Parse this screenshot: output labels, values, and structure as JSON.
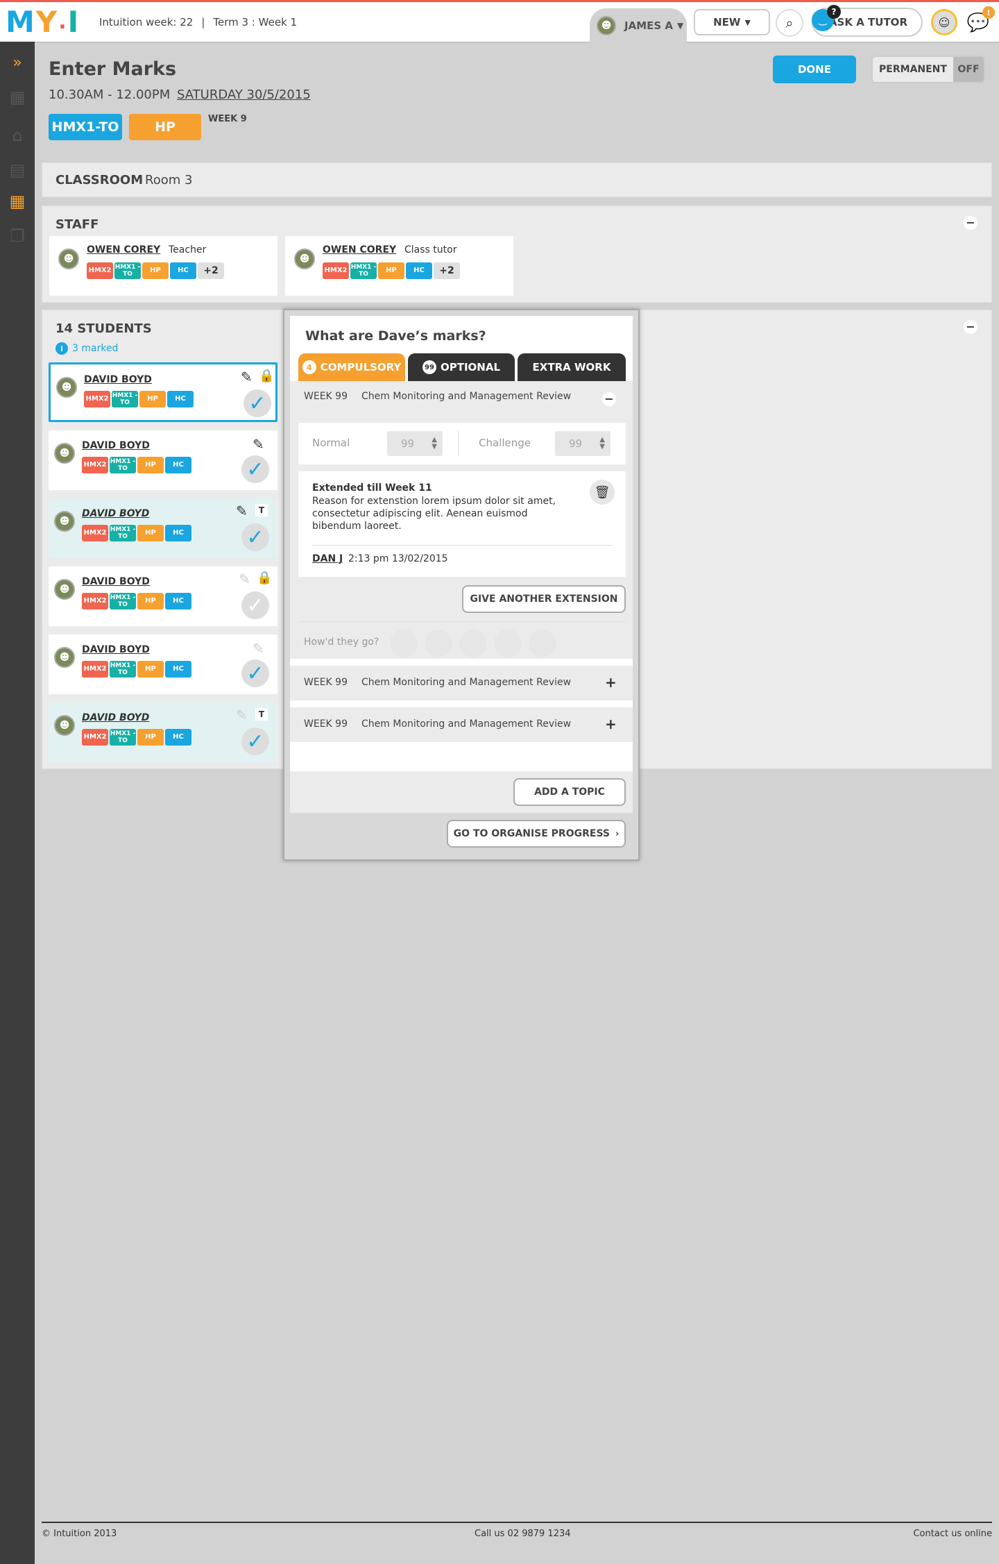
{
  "topbar": {
    "logo_letters": [
      "M",
      "Y",
      "I"
    ],
    "week_info": "Intuition week: 22",
    "separator": "|",
    "term_info": "Term 3 : Week 1",
    "user_label": "JAMES A",
    "new_label": "NEW",
    "ask_tutor_label": "ASK A TUTOR",
    "question_badge": "?",
    "alert_badge": "!"
  },
  "header": {
    "title": "Enter Marks",
    "time": "10.30AM - 12.00PM",
    "date": "SATURDAY 30/5/2015",
    "tag1": "HMX1-TO",
    "tag2": "HP",
    "week": "WEEK 9",
    "done_label": "DONE",
    "permanent_label": "PERMANENT",
    "off_label": "OFF"
  },
  "classroom": {
    "label": "CLASSROOM",
    "room": "Room 3"
  },
  "staff": {
    "title": "STAFF",
    "members": [
      {
        "name": "OWEN COREY",
        "role": "Teacher",
        "badges": [
          "HMX2",
          "HMX1 -TO",
          "HP",
          "HC"
        ],
        "more": "+2"
      },
      {
        "name": "OWEN COREY",
        "role": "Class tutor",
        "badges": [
          "HMX2",
          "HMX1 -TO",
          "HP",
          "HC"
        ],
        "more": "+2"
      }
    ]
  },
  "students": {
    "title": "14 STUDENTS",
    "info_icon": "i",
    "marked": "3 marked",
    "list": [
      {
        "name": "DAVID BOYD",
        "badges": [
          "HMX2",
          "HMX1 -TO",
          "HP",
          "HC"
        ],
        "flag": ""
      },
      {
        "name": "DAVID BOYD",
        "badges": [
          "HMX2",
          "HMX1 -TO",
          "HP",
          "HC"
        ],
        "flag": ""
      },
      {
        "name": "DAVID BOYD",
        "badges": [
          "HMX2",
          "HMX1 -TO",
          "HP",
          "HC"
        ],
        "flag": "T"
      },
      {
        "name": "DAVID BOYD",
        "badges": [
          "HMX2",
          "HMX1 -TO",
          "HP",
          "HC"
        ],
        "flag": ""
      },
      {
        "name": "DAVID BOYD",
        "badges": [
          "HMX2",
          "HMX1 -TO",
          "HP",
          "HC"
        ],
        "flag": ""
      },
      {
        "name": "DAVID BOYD",
        "badges": [
          "HMX2",
          "HMX1 -TO",
          "HP",
          "HC"
        ],
        "flag": "T"
      }
    ]
  },
  "modal": {
    "title": "What are Dave’s marks?",
    "tabs": {
      "compulsory_count": "4",
      "compulsory": "COMPULSORY",
      "optional_count": "99",
      "optional": "OPTIONAL",
      "extra": "EXTRA WORK"
    },
    "topic1": {
      "week": "WEEK 99",
      "name": "Chem Monitoring and Management Review"
    },
    "normal_label": "Normal",
    "normal_value": "99",
    "challenge_label": "Challenge",
    "challenge_value": "99",
    "extension": {
      "title": "Extended till Week 11",
      "reason": "Reason for extenstion lorem ipsum dolor sit amet, consectetur adipiscing elit. Aenean euismod bibendum laoreet.",
      "author": "DAN J",
      "timestamp": "2:13 pm 13/02/2015"
    },
    "give_extension": "GIVE ANOTHER EXTENSION",
    "howd_they_go": "How'd they go?",
    "topic2": {
      "week": "WEEK 99",
      "name": "Chem Monitoring and Management Review"
    },
    "topic3": {
      "week": "WEEK 99",
      "name": "Chem Monitoring and Management Review"
    },
    "add_topic": "ADD A TOPIC",
    "organise": "GO TO ORGANISE PROGRESS"
  },
  "footer": {
    "copyright": "© Intuition 2013",
    "phone": "Call us 02 9879 1234",
    "contact": "Contact us online"
  },
  "colors": {
    "accent_red": "#f15a4a",
    "blue": "#1aa6e0",
    "orange": "#f6a030",
    "teal": "#16b0a6"
  }
}
